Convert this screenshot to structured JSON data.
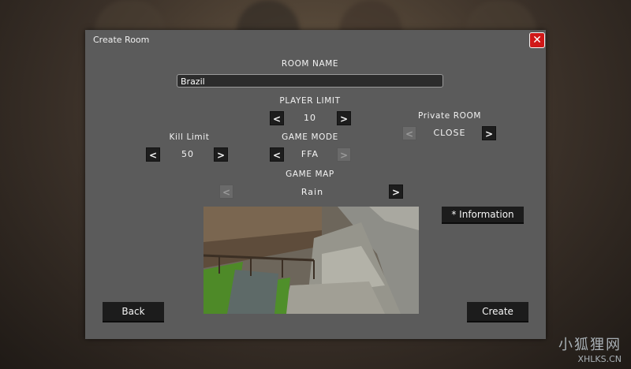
{
  "dialog": {
    "title": "Create Room"
  },
  "room_name": {
    "label": "ROOM NAME",
    "value": "Brazil"
  },
  "player_limit": {
    "label": "PLAYER LIMIT",
    "value": "10",
    "prev": "<",
    "next": ">"
  },
  "private_room": {
    "label": "Private ROOM",
    "value": "CLOSE",
    "prev": "<",
    "next": ">"
  },
  "kill_limit": {
    "label": "Kill Limit",
    "value": "50",
    "prev": "<",
    "next": ">"
  },
  "game_mode": {
    "label": "GAME MODE",
    "value": "FFA",
    "prev": "<",
    "next": ">"
  },
  "game_map": {
    "label": "GAME MAP",
    "value": "Rain",
    "prev": "<",
    "next": ">"
  },
  "buttons": {
    "information": "* Information",
    "back": "Back",
    "create": "Create",
    "close": "✕"
  },
  "watermark": {
    "text_cn": "小狐狸网",
    "text_en": "XHLKS.CN"
  },
  "colors": {
    "panel": "#5b5b5b",
    "button": "#1c1c1c",
    "close": "#d01818"
  }
}
